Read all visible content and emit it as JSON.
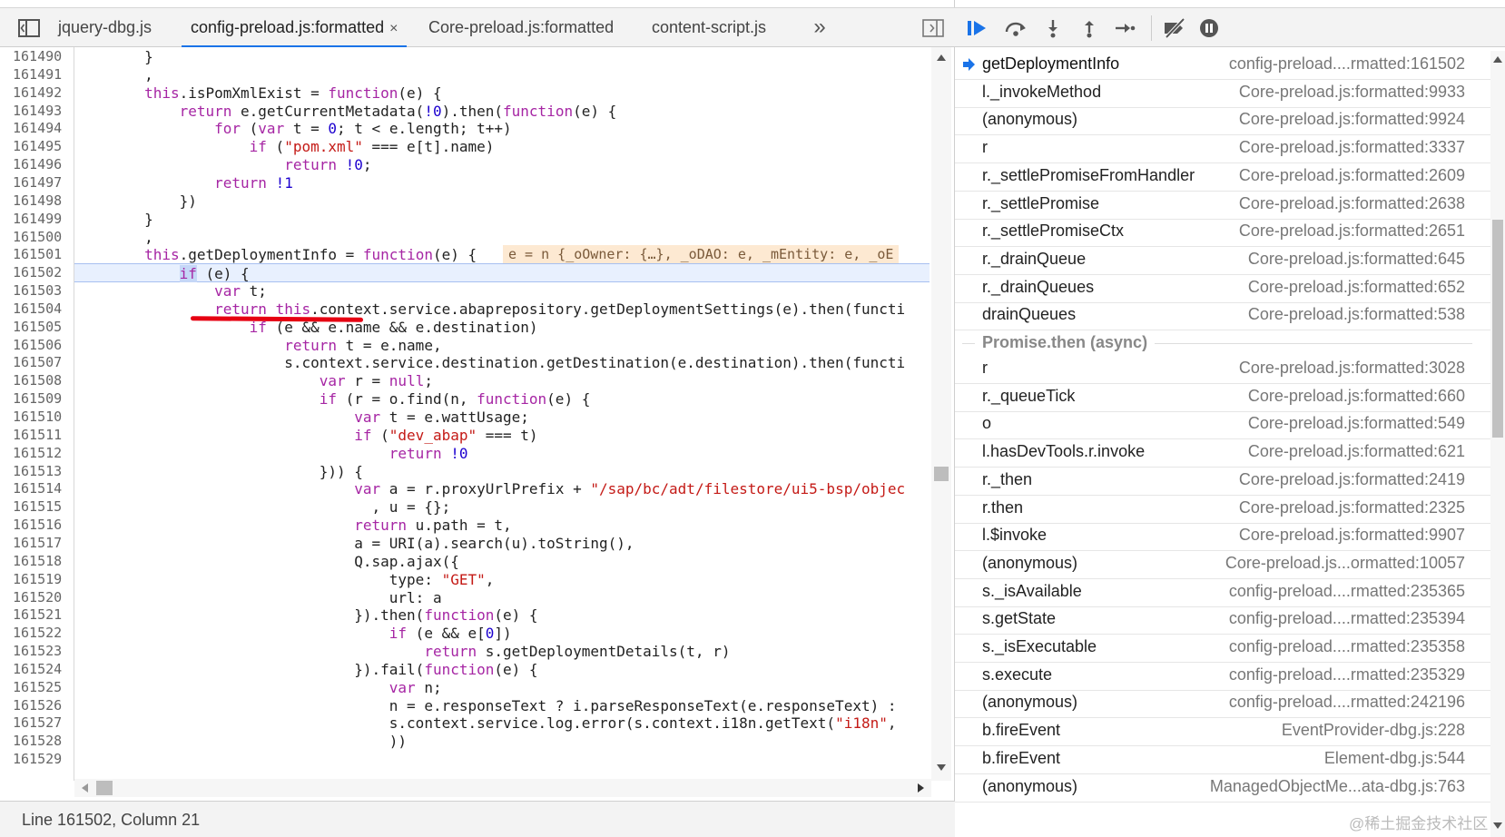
{
  "tabs": [
    {
      "label": "jquery-dbg.js",
      "active": false
    },
    {
      "label": "config-preload.js:formatted",
      "active": true,
      "close": "×"
    },
    {
      "label": "Core-preload.js:formatted",
      "active": false
    },
    {
      "label": "content-script.js",
      "active": false
    }
  ],
  "tabs_overflow": "»",
  "line_numbers": [
    "161490",
    "161491",
    "161492",
    "161493",
    "161494",
    "161495",
    "161496",
    "161497",
    "161498",
    "161499",
    "161500",
    "161501",
    "161502",
    "161503",
    "161504",
    "161505",
    "161506",
    "161507",
    "161508",
    "161509",
    "161510",
    "161511",
    "161512",
    "161513",
    "161514",
    "161515",
    "161516",
    "161517",
    "161518",
    "161519",
    "161520",
    "161521",
    "161522",
    "161523",
    "161524",
    "161525",
    "161526",
    "161527",
    "161528",
    "161529"
  ],
  "code_lines": [
    [
      {
        "t": "        }"
      }
    ],
    [
      {
        "t": "        ,"
      }
    ],
    [
      {
        "t": "        this",
        "c": "kw"
      },
      {
        "t": ".isPomXmlExist = "
      },
      {
        "t": "function",
        "c": "kw"
      },
      {
        "t": "(e) {"
      }
    ],
    [
      {
        "t": "            "
      },
      {
        "t": "return",
        "c": "kw"
      },
      {
        "t": " e.getCurrentMetadata("
      },
      {
        "t": "!0",
        "c": "num"
      },
      {
        "t": ").then("
      },
      {
        "t": "function",
        "c": "kw"
      },
      {
        "t": "(e) {"
      }
    ],
    [
      {
        "t": "                "
      },
      {
        "t": "for",
        "c": "kw"
      },
      {
        "t": " ("
      },
      {
        "t": "var",
        "c": "kw"
      },
      {
        "t": " t = "
      },
      {
        "t": "0",
        "c": "num"
      },
      {
        "t": "; t < e.length; t++)"
      }
    ],
    [
      {
        "t": "                    "
      },
      {
        "t": "if",
        "c": "kw"
      },
      {
        "t": " ("
      },
      {
        "t": "\"pom.xml\"",
        "c": "str"
      },
      {
        "t": " === e[t].name)"
      }
    ],
    [
      {
        "t": "                        "
      },
      {
        "t": "return",
        "c": "kw"
      },
      {
        "t": " "
      },
      {
        "t": "!0",
        "c": "num"
      },
      {
        "t": ";"
      }
    ],
    [
      {
        "t": "                "
      },
      {
        "t": "return",
        "c": "kw"
      },
      {
        "t": " "
      },
      {
        "t": "!1",
        "c": "num"
      }
    ],
    [
      {
        "t": "            })"
      }
    ],
    [
      {
        "t": "        }"
      }
    ],
    [
      {
        "t": "        ,"
      }
    ],
    [
      {
        "t": "        "
      },
      {
        "t": "this",
        "c": "kw"
      },
      {
        "t": ".getDeploymentInfo = "
      },
      {
        "t": "function",
        "c": "kw"
      },
      {
        "t": "(e) {"
      }
    ],
    [
      {
        "t": "            "
      },
      {
        "t": "if",
        "c": "kw mark"
      },
      {
        "t": " (e) {"
      }
    ],
    [
      {
        "t": "                "
      },
      {
        "t": "var",
        "c": "kw"
      },
      {
        "t": " t;"
      }
    ],
    [
      {
        "t": "                "
      },
      {
        "t": "return",
        "c": "kw"
      },
      {
        "t": " "
      },
      {
        "t": "this",
        "c": "kw"
      },
      {
        "t": ".context.service.abaprepository.getDeploymentSettings(e).then(functi"
      }
    ],
    [
      {
        "t": "                    "
      },
      {
        "t": "if",
        "c": "kw"
      },
      {
        "t": " (e && e.name && e.destination)"
      }
    ],
    [
      {
        "t": "                        "
      },
      {
        "t": "return",
        "c": "kw"
      },
      {
        "t": " t = e.name,"
      }
    ],
    [
      {
        "t": "                        s.context.service.destination.getDestination(e.destination).then(functi"
      }
    ],
    [
      {
        "t": "                            "
      },
      {
        "t": "var",
        "c": "kw"
      },
      {
        "t": " r = "
      },
      {
        "t": "null",
        "c": "kw"
      },
      {
        "t": ";"
      }
    ],
    [
      {
        "t": "                            "
      },
      {
        "t": "if",
        "c": "kw"
      },
      {
        "t": " (r = o.find(n, "
      },
      {
        "t": "function",
        "c": "kw"
      },
      {
        "t": "(e) {"
      }
    ],
    [
      {
        "t": "                                "
      },
      {
        "t": "var",
        "c": "kw"
      },
      {
        "t": " t = e.wattUsage;"
      }
    ],
    [
      {
        "t": "                                "
      },
      {
        "t": "if",
        "c": "kw"
      },
      {
        "t": " ("
      },
      {
        "t": "\"dev_abap\"",
        "c": "str"
      },
      {
        "t": " === t)"
      }
    ],
    [
      {
        "t": "                                    "
      },
      {
        "t": "return",
        "c": "kw"
      },
      {
        "t": " "
      },
      {
        "t": "!0",
        "c": "num"
      }
    ],
    [
      {
        "t": "                            })) {"
      }
    ],
    [
      {
        "t": "                                "
      },
      {
        "t": "var",
        "c": "kw"
      },
      {
        "t": " a = r.proxyUrlPrefix + "
      },
      {
        "t": "\"/sap/bc/adt/filestore/ui5-bsp/objec",
        "c": "str"
      }
    ],
    [
      {
        "t": "                                  , u = {};"
      }
    ],
    [
      {
        "t": "                                "
      },
      {
        "t": "return",
        "c": "kw"
      },
      {
        "t": " u.path = t,"
      }
    ],
    [
      {
        "t": "                                a = URI(a).search(u).toString(),"
      }
    ],
    [
      {
        "t": "                                Q.sap.ajax({"
      }
    ],
    [
      {
        "t": "                                    type: "
      },
      {
        "t": "\"GET\"",
        "c": "str"
      },
      {
        "t": ","
      }
    ],
    [
      {
        "t": "                                    url: a"
      }
    ],
    [
      {
        "t": "                                }).then("
      },
      {
        "t": "function",
        "c": "kw"
      },
      {
        "t": "(e) {"
      }
    ],
    [
      {
        "t": "                                    "
      },
      {
        "t": "if",
        "c": "kw"
      },
      {
        "t": " (e && e["
      },
      {
        "t": "0",
        "c": "num"
      },
      {
        "t": "])"
      }
    ],
    [
      {
        "t": "                                        "
      },
      {
        "t": "return",
        "c": "kw"
      },
      {
        "t": " s.getDeploymentDetails(t, r)"
      }
    ],
    [
      {
        "t": "                                }).fail("
      },
      {
        "t": "function",
        "c": "kw"
      },
      {
        "t": "(e) {"
      }
    ],
    [
      {
        "t": "                                    "
      },
      {
        "t": "var",
        "c": "kw"
      },
      {
        "t": " n;"
      }
    ],
    [
      {
        "t": "                                    n = e.responseText ? i.parseResponseText(e.responseText) :"
      }
    ],
    [
      {
        "t": "                                    s.context.service.log.error(s.context.i18n.getText("
      },
      {
        "t": "\"i18n\"",
        "c": "str"
      },
      {
        "t": ","
      }
    ],
    [
      {
        "t": "                                    ))"
      }
    ],
    [
      {
        "t": ""
      }
    ]
  ],
  "current_line_index": 12,
  "inline_value": {
    "line_index": 11,
    "text": "e = n {_oOwner: {…}, _oDAO: e, _mEntity: e, _oE"
  },
  "status_bar": "Line 161502, Column 21",
  "call_stack": [
    {
      "name": "getDeploymentInfo",
      "location": "config-preload....rmatted:161502",
      "current": true
    },
    {
      "name": "l._invokeMethod",
      "location": "Core-preload.js:formatted:9933"
    },
    {
      "name": "(anonymous)",
      "location": "Core-preload.js:formatted:9924"
    },
    {
      "name": "r",
      "location": "Core-preload.js:formatted:3337"
    },
    {
      "name": "r._settlePromiseFromHandler",
      "location": "Core-preload.js:formatted:2609"
    },
    {
      "name": "r._settlePromise",
      "location": "Core-preload.js:formatted:2638"
    },
    {
      "name": "r._settlePromiseCtx",
      "location": "Core-preload.js:formatted:2651"
    },
    {
      "name": "r._drainQueue",
      "location": "Core-preload.js:formatted:645"
    },
    {
      "name": "r._drainQueues",
      "location": "Core-preload.js:formatted:652"
    },
    {
      "name": "drainQueues",
      "location": "Core-preload.js:formatted:538"
    },
    {
      "separator": "Promise.then (async)"
    },
    {
      "name": "r",
      "location": "Core-preload.js:formatted:3028"
    },
    {
      "name": "r._queueTick",
      "location": "Core-preload.js:formatted:660"
    },
    {
      "name": "o",
      "location": "Core-preload.js:formatted:549"
    },
    {
      "name": "l.hasDevTools.r.invoke",
      "location": "Core-preload.js:formatted:621"
    },
    {
      "name": "r._then",
      "location": "Core-preload.js:formatted:2419"
    },
    {
      "name": "r.then",
      "location": "Core-preload.js:formatted:2325"
    },
    {
      "name": "l.$invoke",
      "location": "Core-preload.js:formatted:9907"
    },
    {
      "name": "(anonymous)",
      "location": "Core-preload.js...ormatted:10057"
    },
    {
      "name": "s._isAvailable",
      "location": "config-preload....rmatted:235365"
    },
    {
      "name": "s.getState",
      "location": "config-preload....rmatted:235394"
    },
    {
      "name": "s._isExecutable",
      "location": "config-preload....rmatted:235358"
    },
    {
      "name": "s.execute",
      "location": "config-preload....rmatted:235329"
    },
    {
      "name": "(anonymous)",
      "location": "config-preload....rmatted:242196"
    },
    {
      "name": "b.fireEvent",
      "location": "EventProvider-dbg.js:228"
    },
    {
      "name": "b.fireEvent",
      "location": "Element-dbg.js:544"
    },
    {
      "name": "(anonymous)",
      "location": "ManagedObjectMe...ata-dbg.js:763"
    }
  ],
  "watermark": "@稀土掘金技术社区",
  "colors": {
    "accent": "#1a73e8",
    "keyword": "#a626a4",
    "string": "#c41a16",
    "number": "#1c00cf",
    "annotation_red": "#e60012",
    "inline_value_bg": "#fde9d2"
  },
  "icons": [
    "navigator-toggle-icon",
    "close-icon",
    "more-tabs-icon",
    "debugger-toggle-icon",
    "resume-icon",
    "step-over-icon",
    "step-into-icon",
    "step-out-icon",
    "step-icon",
    "deactivate-breakpoints-icon",
    "pause-on-exceptions-icon",
    "current-frame-arrow-icon"
  ]
}
